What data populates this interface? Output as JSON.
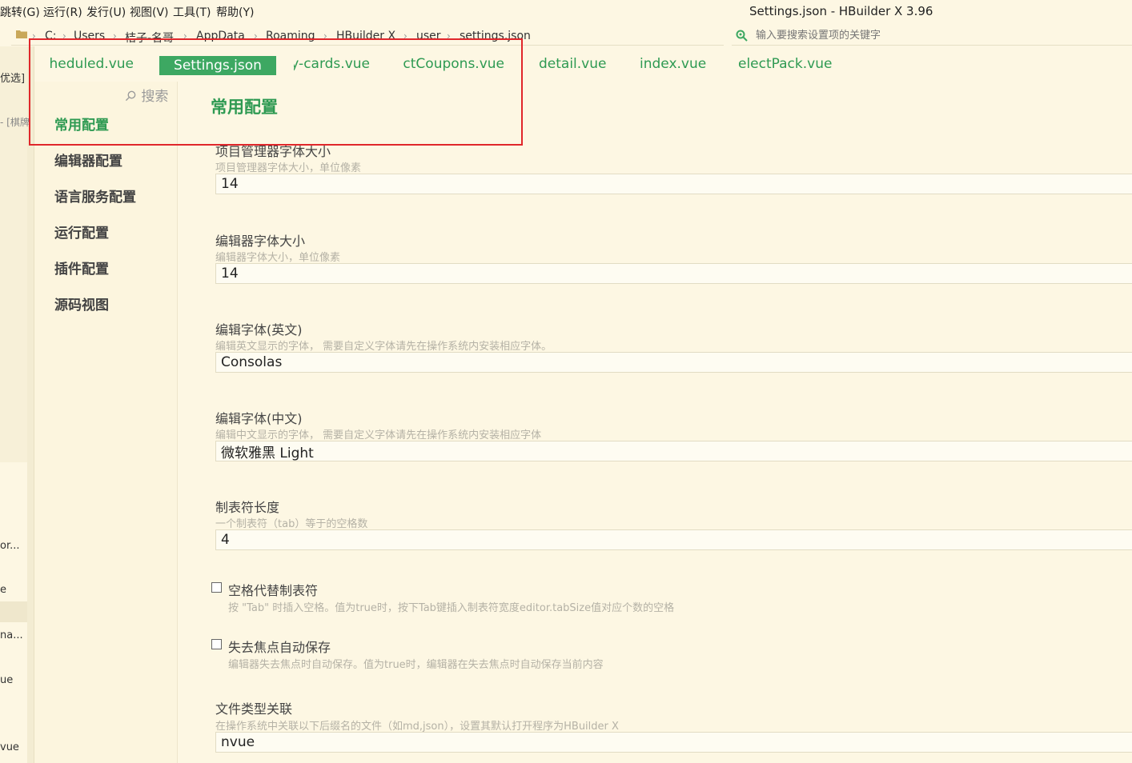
{
  "menu": {
    "items": [
      "跳转(G)",
      "运行(R)",
      "发行(U)",
      "视图(V)",
      "工具(T)",
      "帮助(Y)"
    ]
  },
  "window": {
    "title": "Settings.json - HBuilder X 3.96"
  },
  "breadcrumb": [
    "C:",
    "Users",
    "桔子-名哥",
    "AppData",
    "Roaming",
    "HBuilder X",
    "user",
    "settings.json"
  ],
  "settings_search": {
    "placeholder": "输入要搜索设置项的关键字"
  },
  "left_panel": {
    "fragments": [
      "优选]",
      "- [棋牌",
      "or...",
      "e",
      "na...",
      "ue",
      "vue"
    ]
  },
  "tabs": [
    {
      "label": "scheduled.vue",
      "active": false
    },
    {
      "label": "Settings.json",
      "active": true
    },
    {
      "label": "my-cards.vue",
      "active": false
    },
    {
      "label": "selectCoupons.vue",
      "active": false
    },
    {
      "label": "detail.vue",
      "active": false
    },
    {
      "label": "index.vue",
      "active": false
    },
    {
      "label": "electPack.vue",
      "active": false
    }
  ],
  "nav": {
    "search_label": "搜索",
    "items": [
      "常用配置",
      "编辑器配置",
      "语言服务配置",
      "运行配置",
      "插件配置",
      "源码视图"
    ]
  },
  "main": {
    "title": "常用配置",
    "settings": [
      {
        "label": "项目管理器字体大小",
        "desc": "项目管理器字体大小，单位像素",
        "value": "14"
      },
      {
        "label": "编辑器字体大小",
        "desc": "编辑器字体大小，单位像素",
        "value": "14"
      },
      {
        "label": "编辑字体(英文)",
        "desc": "编辑英文显示的字体， 需要自定义字体请先在操作系统内安装相应字体。",
        "value": "Consolas"
      },
      {
        "label": "编辑字体(中文)",
        "desc": "编辑中文显示的字体， 需要自定义字体请先在操作系统内安装相应字体",
        "value": "微软雅黑 Light"
      },
      {
        "label": "制表符长度",
        "desc": "一个制表符（tab）等于的空格数",
        "value": "4"
      }
    ],
    "checks": [
      {
        "label": "空格代替制表符",
        "desc": "按 \"Tab\" 时插入空格。值为true时，按下Tab键插入制表符宽度editor.tabSize值对应个数的空格",
        "checked": false
      },
      {
        "label": "失去焦点自动保存",
        "desc": "编辑器失去焦点时自动保存。值为true时，编辑器在失去焦点时自动保存当前内容",
        "checked": false
      }
    ],
    "file_assoc": {
      "label": "文件类型关联",
      "desc": "在操作系统中关联以下后缀名的文件（如md,json），设置其默认打开程序为HBuilder X",
      "value": "nvue"
    }
  },
  "colors": {
    "accent": "#2e9a52",
    "highlight": "#e0272b",
    "background": "#fdf7e3"
  }
}
